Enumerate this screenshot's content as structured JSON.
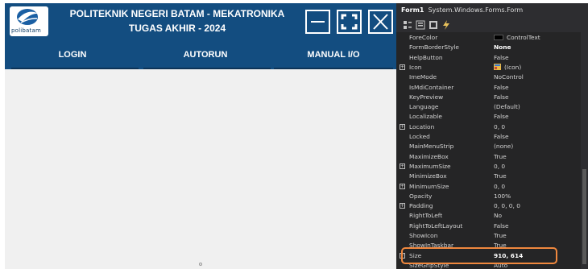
{
  "form": {
    "logo_text": "polibatam",
    "title_line1": "POLITEKNIK NEGERI BATAM - MEKATRONIKA",
    "title_line2": "TUGAS AKHIR - 2024",
    "nav_items": [
      "LOGIN",
      "AUTORUN",
      "MANUAL I/O"
    ],
    "header_color": "#134d80"
  },
  "properties_panel": {
    "object_name": "Form1",
    "object_type": "System.Windows.Forms.Form",
    "toolbar_icons": [
      "categorized-icon",
      "alphabetical-icon",
      "properties-icon",
      "events-icon"
    ],
    "rows": [
      {
        "name": "ForeColor",
        "value": "ControlText",
        "swatch": "#000000"
      },
      {
        "name": "FormBorderStyle",
        "value": "None",
        "bold": true
      },
      {
        "name": "HelpButton",
        "value": "False"
      },
      {
        "name": "Icon",
        "value": "(Icon)",
        "expandable": true,
        "icon": true
      },
      {
        "name": "ImeMode",
        "value": "NoControl"
      },
      {
        "name": "IsMdiContainer",
        "value": "False"
      },
      {
        "name": "KeyPreview",
        "value": "False"
      },
      {
        "name": "Language",
        "value": "(Default)"
      },
      {
        "name": "Localizable",
        "value": "False"
      },
      {
        "name": "Location",
        "value": "0, 0",
        "expandable": true
      },
      {
        "name": "Locked",
        "value": "False"
      },
      {
        "name": "MainMenuStrip",
        "value": "(none)"
      },
      {
        "name": "MaximizeBox",
        "value": "True"
      },
      {
        "name": "MaximumSize",
        "value": "0, 0",
        "expandable": true
      },
      {
        "name": "MinimizeBox",
        "value": "True"
      },
      {
        "name": "MinimumSize",
        "value": "0, 0",
        "expandable": true
      },
      {
        "name": "Opacity",
        "value": "100%"
      },
      {
        "name": "Padding",
        "value": "0, 0, 0, 0",
        "expandable": true
      },
      {
        "name": "RightToLeft",
        "value": "No"
      },
      {
        "name": "RightToLeftLayout",
        "value": "False"
      },
      {
        "name": "ShowIcon",
        "value": "True"
      },
      {
        "name": "ShowInTaskbar",
        "value": "True"
      },
      {
        "name": "Size",
        "value": "910, 614",
        "expandable": true,
        "bold": true
      },
      {
        "name": "SizeGripStyle",
        "value": "Auto"
      }
    ],
    "highlight_color": "#f0883e"
  }
}
